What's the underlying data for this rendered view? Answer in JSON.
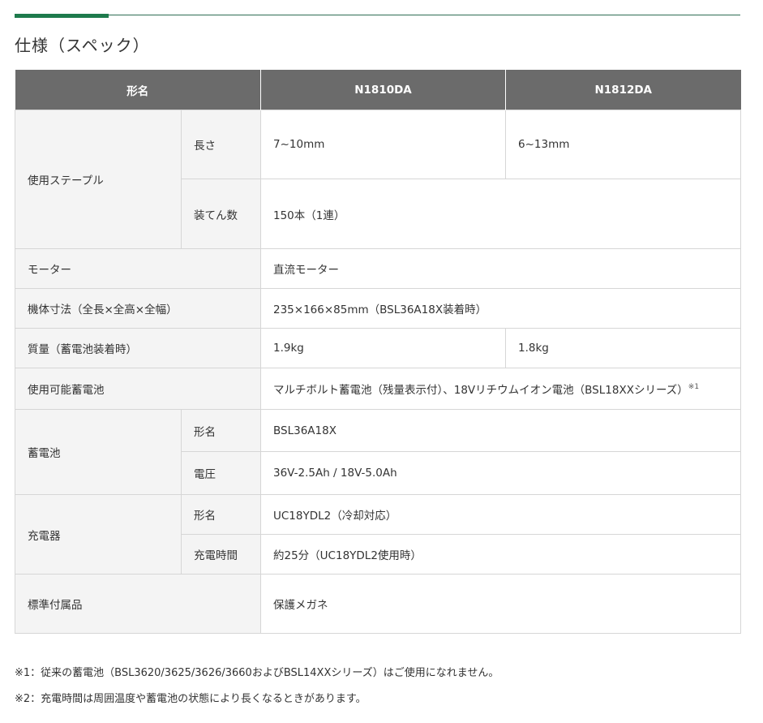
{
  "heading": "仕様（スペック）",
  "table": {
    "header": {
      "label": "形名",
      "model1": "N1810DA",
      "model2": "N1812DA"
    },
    "staple": {
      "label": "使用ステープル",
      "length_label": "長さ",
      "length_1": "7~10mm",
      "length_2": "6~13mm",
      "capacity_label": "装てん数",
      "capacity": "150本（1連）"
    },
    "motor": {
      "label": "モーター",
      "value": "直流モーター"
    },
    "dimensions": {
      "label": "機体寸法（全長×全高×全幅）",
      "value": "235×166×85mm（BSL36A18X装着時）"
    },
    "weight": {
      "label": "質量（蓄電池装着時）",
      "value_1": "1.9kg",
      "value_2": "1.8kg"
    },
    "usable_battery": {
      "label": "使用可能蓄電池",
      "value": "マルチボルト蓄電池（残量表示付）、18Vリチウムイオン電池（BSL18XXシリーズ）",
      "note_mark": "※1"
    },
    "battery": {
      "label": "蓄電池",
      "model_label": "形名",
      "model": "BSL36A18X",
      "voltage_label": "電圧",
      "voltage": "36V-2.5Ah / 18V-5.0Ah"
    },
    "charger": {
      "label": "充電器",
      "model_label": "形名",
      "model": "UC18YDL2（冷却対応）",
      "time_label": "充電時間",
      "time": "約25分（UC18YDL2使用時）"
    },
    "accessories": {
      "label": "標準付属品",
      "value": "保護メガネ"
    }
  },
  "footnotes": [
    "※1：従来の蓄電池（BSL3620/3625/3626/3660およびBSL14XXシリーズ）はご使用になれません。",
    "※2：充電時間は周囲温度や蓄電池の状態により長くなるときがあります。"
  ]
}
